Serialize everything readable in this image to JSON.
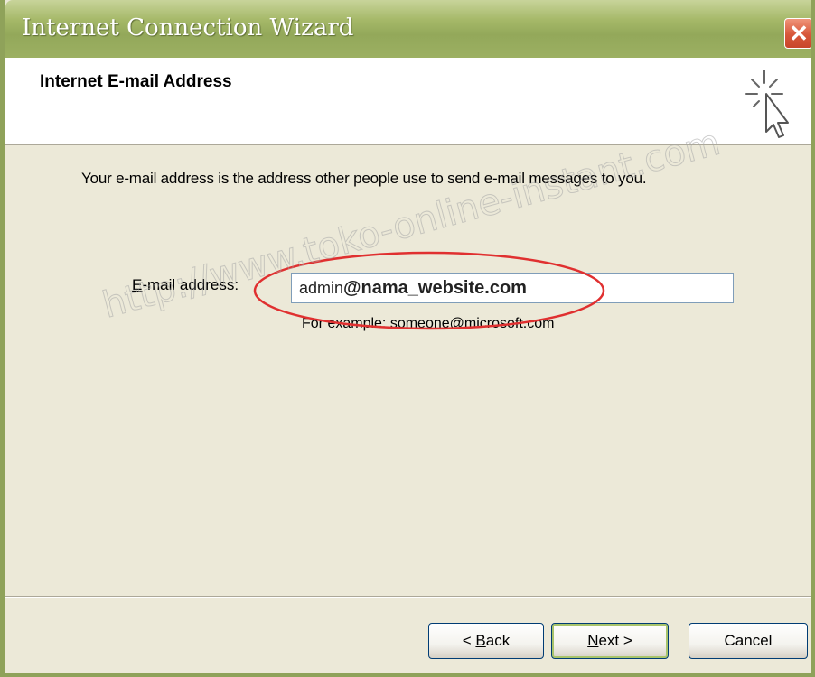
{
  "window": {
    "title": "Internet Connection Wizard",
    "close_glyph": "✕"
  },
  "header": {
    "title": "Internet E-mail Address",
    "icon": "wizard-cursor-sparkle-icon"
  },
  "main": {
    "description": "Your e-mail address is the address other people use to send e-mail messages to you.",
    "email_label_mnemonic": "E",
    "email_label_rest": "-mail address:",
    "email_value_user": "admin",
    "email_value_at": "@",
    "email_value_domain": "nama_website.com",
    "example": "For example: someone@microsoft.com"
  },
  "buttons": {
    "back_prefix": "< ",
    "back_mnemonic": "B",
    "back_rest": "ack",
    "next_mnemonic": "N",
    "next_rest": "ext >",
    "cancel": "Cancel"
  },
  "watermark": {
    "text": "http://www.toko-online-instant.com"
  },
  "colors": {
    "titlebar": "#9cb062",
    "close_button": "#d7573a",
    "highlight_ellipse": "#e03030",
    "dialog_background": "#ece9d8"
  }
}
